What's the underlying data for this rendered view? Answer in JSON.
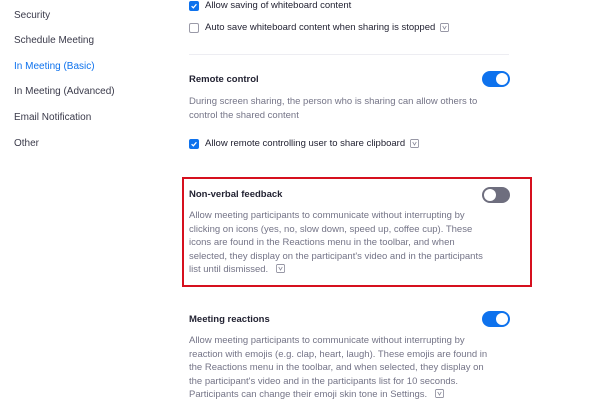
{
  "sidebar": {
    "items": [
      {
        "label": "Security"
      },
      {
        "label": "Schedule Meeting"
      },
      {
        "label": "In Meeting (Basic)",
        "active": true
      },
      {
        "label": "In Meeting (Advanced)"
      },
      {
        "label": "Email Notification"
      },
      {
        "label": "Other"
      }
    ]
  },
  "whiteboard": {
    "allow_saving": {
      "label": "Allow saving of whiteboard content",
      "checked": true
    },
    "auto_save": {
      "label": "Auto save whiteboard content when sharing is stopped",
      "checked": false
    }
  },
  "remote_control": {
    "title": "Remote control",
    "enabled": true,
    "description": "During screen sharing, the person who is sharing can allow others to control the shared content",
    "clipboard": {
      "label": "Allow remote controlling user to share clipboard",
      "checked": true
    }
  },
  "nonverbal_feedback": {
    "title": "Non-verbal feedback",
    "enabled": false,
    "description": "Allow meeting participants to communicate without interrupting by clicking on icons (yes, no, slow down, speed up, coffee cup). These icons are found in the Reactions menu in the toolbar, and when selected, they display on the participant's video and in the participants list until dismissed."
  },
  "meeting_reactions": {
    "title": "Meeting reactions",
    "enabled": true,
    "description": "Allow meeting participants to communicate without interrupting by reaction with emojis (e.g. clap, heart, laugh). These emojis are found in the Reactions menu in the toolbar, and when selected, they display on the participant's video and in the participants list for 10 seconds. Participants can change their emoji skin tone in Settings."
  },
  "colors": {
    "accent": "#0e72ed",
    "toggle_off": "#6e6e7e",
    "highlight_border": "#d6101e",
    "description_text": "#747487"
  },
  "icons": {
    "checkbox_check": "checkmark-icon",
    "info": "info-icon"
  }
}
